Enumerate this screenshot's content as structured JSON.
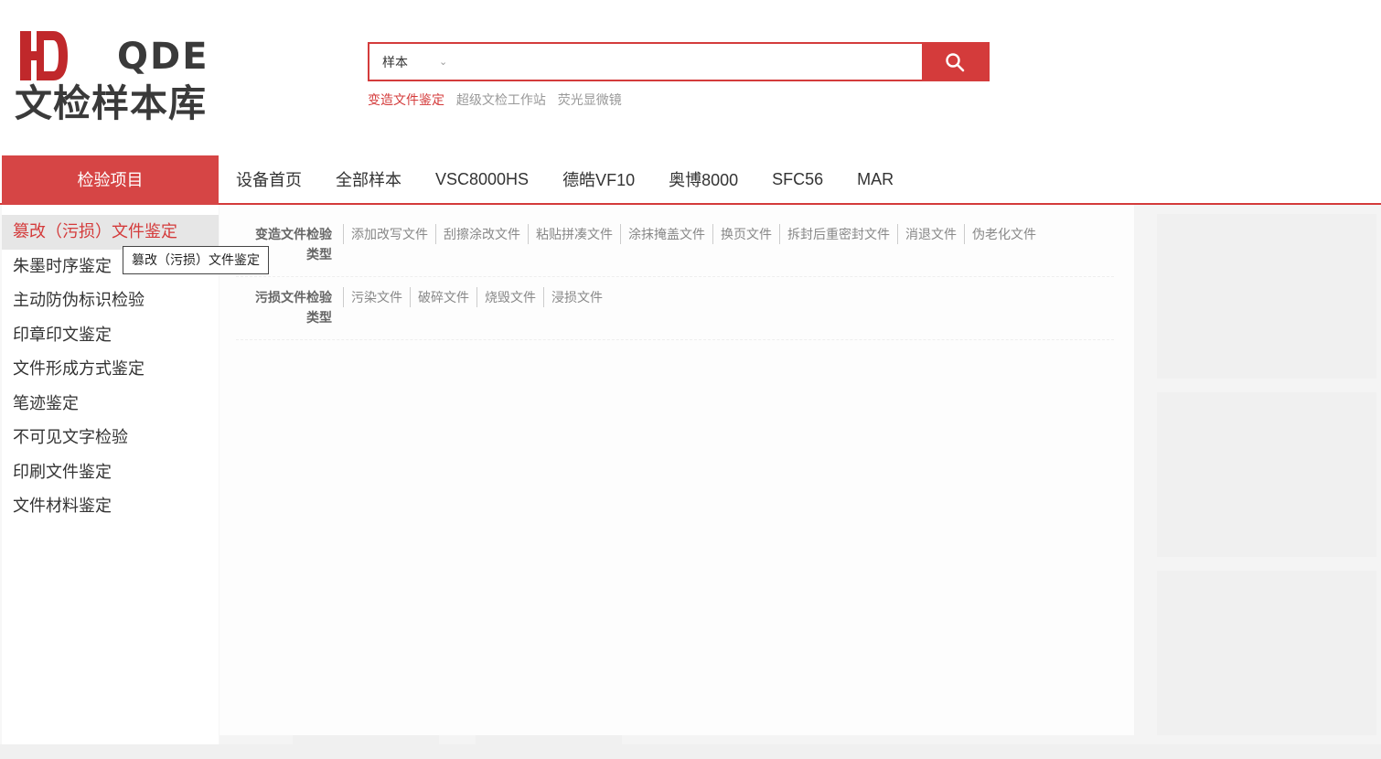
{
  "logo": {
    "mark": "H",
    "text_en": "QDE",
    "text_cn": "文检样本库"
  },
  "search": {
    "select_value": "样本",
    "input_value": "",
    "placeholder": "",
    "hot_links": [
      "变造文件鉴定",
      "超级文检工作站",
      "荧光显微镜"
    ]
  },
  "nav": {
    "category_label": "检验项目",
    "items": [
      "设备首页",
      "全部样本",
      "VSC8000HS",
      "德皓VF10",
      "奥博8000",
      "SFC56",
      "MAR"
    ]
  },
  "sidebar": {
    "items": [
      "篡改（污损）文件鉴定",
      "朱墨时序鉴定",
      "主动防伪标识检验",
      "印章印文鉴定",
      "文件形成方式鉴定",
      "笔迹鉴定",
      "不可见文字检验",
      "印刷文件鉴定",
      "文件材料鉴定"
    ],
    "tooltip": "篡改（污损）文件鉴定"
  },
  "dropdown": {
    "groups": [
      {
        "title_line1": "变造文件检验",
        "title_line2": "类型",
        "links": [
          "添加改写文件",
          "刮擦涂改文件",
          "粘贴拼凑文件",
          "涂抹掩盖文件",
          "换页文件",
          "拆封后重密封文件",
          "消退文件",
          "伪老化文件"
        ]
      },
      {
        "title_line1": "污损文件检验",
        "title_line2": "类型",
        "links": [
          "污染文件",
          "破碎文件",
          "烧毁文件",
          "浸损文件"
        ]
      }
    ]
  },
  "colors": {
    "accent": "#d43b3b",
    "category_bg": "#d64545",
    "active_item_bg": "#e6e6e6"
  }
}
